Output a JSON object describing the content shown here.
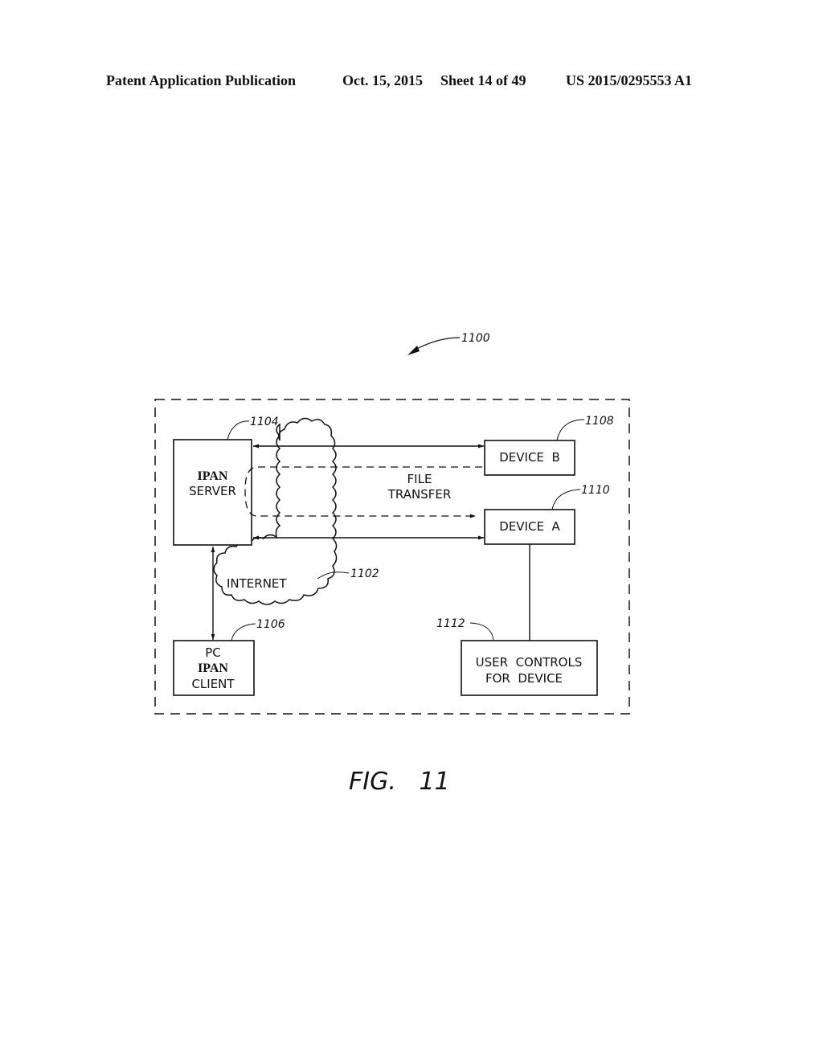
{
  "header": {
    "publication": "Patent Application Publication",
    "date": "Oct. 15, 2015",
    "sheet": "Sheet 14 of 49",
    "number": "US 2015/0295553 A1"
  },
  "figure": {
    "caption": "FIG.   11",
    "system_ref": "1100"
  },
  "nodes": {
    "ipan_server": {
      "line1": "IPAN",
      "line2": "SERVER",
      "ref": "1104"
    },
    "pc_client": {
      "line1": "PC",
      "line2": "IPAN",
      "line3": "CLIENT",
      "ref": "1106"
    },
    "device_b": {
      "label": "DEVICE  B",
      "ref": "1108"
    },
    "device_a": {
      "label": "DEVICE  A",
      "ref": "1110"
    },
    "user_controls": {
      "line1": "USER  CONTROLS",
      "line2": "FOR  DEVICE",
      "ref": "1112"
    },
    "internet": {
      "label": "INTERNET",
      "ref": "1102"
    }
  },
  "annotations": {
    "file_transfer_line1": "FILE",
    "file_transfer_line2": "TRANSFER"
  }
}
